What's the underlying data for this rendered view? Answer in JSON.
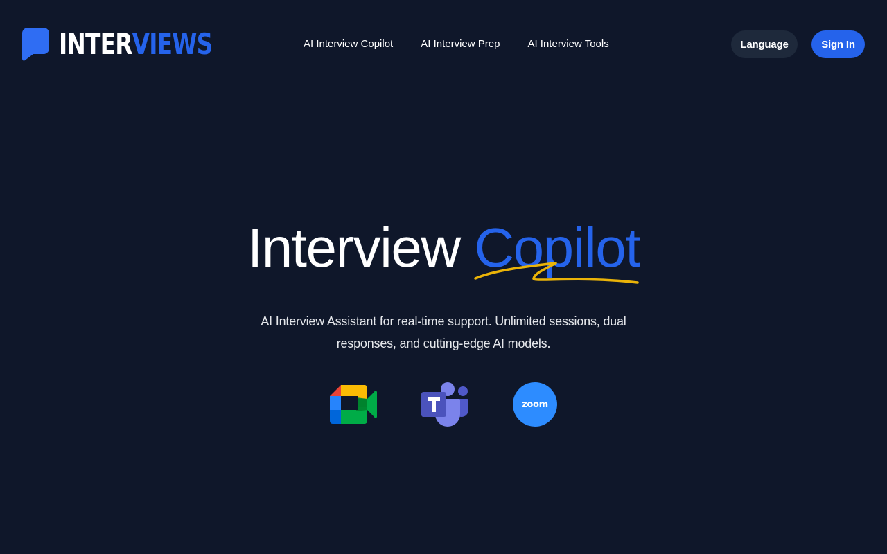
{
  "header": {
    "logo": {
      "part1": "INTER",
      "part2": "VIEWS",
      "icon": "speech-bubble-icon"
    },
    "nav": [
      {
        "label": "AI Interview Copilot"
      },
      {
        "label": "AI Interview Prep"
      },
      {
        "label": "AI Interview Tools"
      }
    ],
    "language_label": "Language",
    "signin_label": "Sign In"
  },
  "hero": {
    "title_main": "Interview",
    "title_accent": "Copilot",
    "subtitle": "AI Interview Assistant for real-time support. Unlimited sessions, dual responses, and cutting-edge AI models.",
    "platforms": [
      {
        "icon": "google-meet-icon"
      },
      {
        "icon": "microsoft-teams-icon"
      },
      {
        "icon": "zoom-icon",
        "label": "zoom"
      }
    ]
  },
  "colors": {
    "background": "#0f172a",
    "accent": "#2563eb",
    "squiggle": "#eab308",
    "language_button": "#1e293b",
    "zoom": "#2d8cff"
  }
}
